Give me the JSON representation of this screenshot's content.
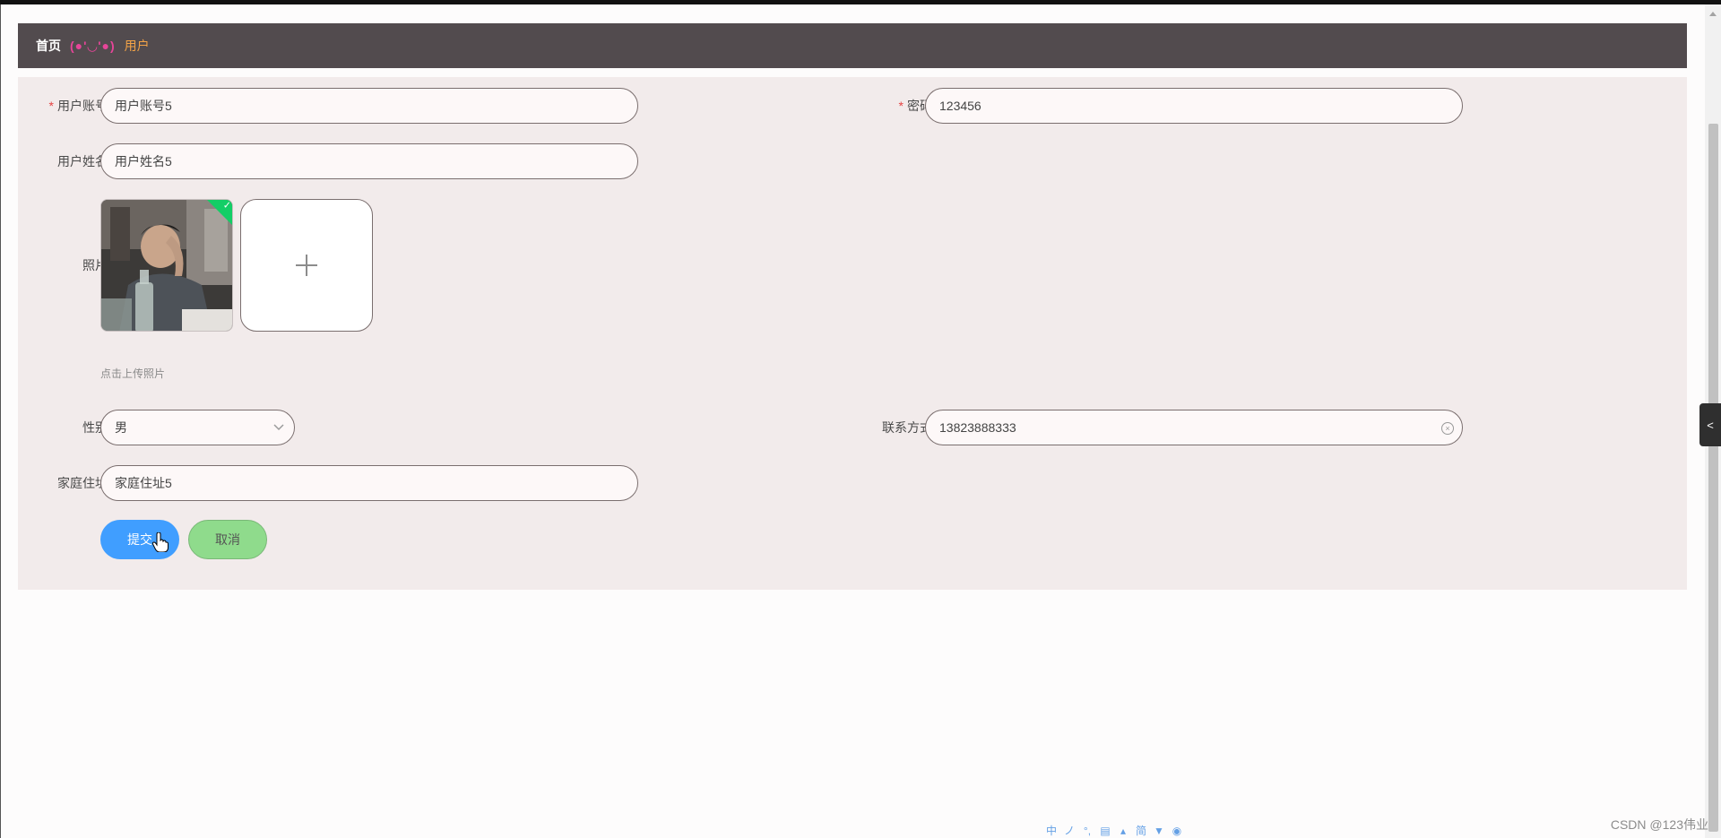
{
  "breadcrumb": {
    "home": "首页",
    "separator": "(●'◡'●)",
    "current": "用户"
  },
  "form": {
    "account": {
      "label": "用户账号",
      "required_mark": "*",
      "value": "用户账号5"
    },
    "password": {
      "label": "密码",
      "required_mark": "*",
      "value": "123456"
    },
    "name": {
      "label": "用户姓名",
      "value": "用户姓名5"
    },
    "photo": {
      "label": "照片",
      "upload_hint": "点击上传照片",
      "add_symbol": "+"
    },
    "gender": {
      "label": "性别",
      "selected": "男"
    },
    "contact": {
      "label": "联系方式",
      "value": "13823888333"
    },
    "address": {
      "label": "家庭住址",
      "value": "家庭住址5"
    }
  },
  "buttons": {
    "submit": "提交",
    "cancel": "取消"
  },
  "side_toggle": {
    "icon": "chevron-left-icon",
    "symbol": "<"
  },
  "watermark": "CSDN @123伟业",
  "ime_toolbar": {
    "items": [
      "中",
      "ノ",
      "°,",
      "▤",
      "▴",
      "简",
      "▼",
      "◉"
    ]
  },
  "colors": {
    "breadcrumb_bg": "#524b4e",
    "home": "#ffffff",
    "separator": "#e64599",
    "current": "#f3a347",
    "panel_bg": "#f2ebeb",
    "submit": "#409eff",
    "cancel": "#8fdb8c",
    "check_badge": "#13ce66"
  }
}
